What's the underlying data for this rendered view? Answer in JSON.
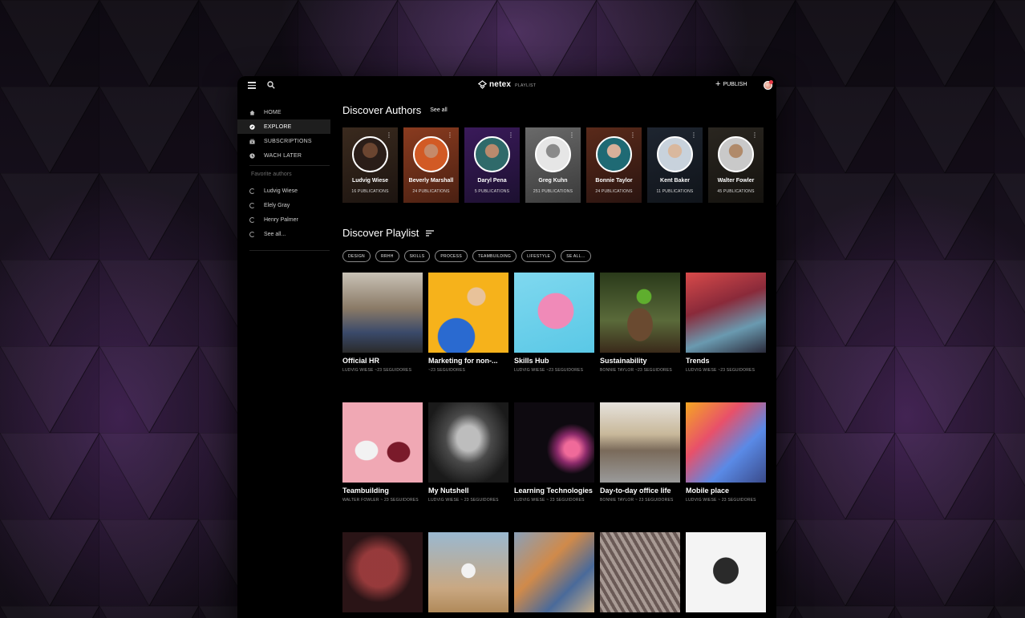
{
  "header": {
    "logo_name": "netex",
    "logo_sub": "PLAYLIST",
    "publish_label": "PUBLISH"
  },
  "sidebar": {
    "nav": [
      {
        "label": "HOME",
        "icon": "home-icon"
      },
      {
        "label": "EXPLORE",
        "icon": "compass-icon",
        "active": true
      },
      {
        "label": "SUBSCRIPTIONS",
        "icon": "subscriptions-icon"
      },
      {
        "label": "WACH LATER",
        "icon": "clock-icon"
      }
    ],
    "favorites_title": "Favorite authors",
    "favorites": [
      "Ludvig Wiese",
      "Elely Gray",
      "Henry Palmer",
      "See all..."
    ]
  },
  "authors_section": {
    "title": "Discover Authors",
    "see_all": "See all",
    "authors": [
      {
        "name": "Ludvig Wiese",
        "pubs": "16 PUBLICATIONS"
      },
      {
        "name": "Beverly Marshall",
        "pubs": "24 PUBLICATIONS"
      },
      {
        "name": "Daryl Pena",
        "pubs": "5 PUBLICATIONS"
      },
      {
        "name": "Greg Kuhn",
        "pubs": "251 PUBLICATIONS"
      },
      {
        "name": "Bonnie Taylor",
        "pubs": "24 PUBLICATIONS"
      },
      {
        "name": "Kent Baker",
        "pubs": "11 PUBLICATIONS"
      },
      {
        "name": "Walter Fowler",
        "pubs": "45 PUBLICATIONS"
      }
    ]
  },
  "playlist_section": {
    "title": "Discover Playlist",
    "filters": [
      "DESIGN",
      "RRHH",
      "SKILLS",
      "PROCESS",
      "TEAMBUILDING",
      "LIFESTYLE",
      "SE ALL..."
    ],
    "items": [
      {
        "title": "Official HR",
        "meta": "LUDVIG WIESE ~23 SEGUIDORES"
      },
      {
        "title": "Marketing for non-...",
        "meta": "~23 SEGUIDORES"
      },
      {
        "title": "Skills Hub",
        "meta": "LUDVIG WIESE ~23 SEGUIDORES"
      },
      {
        "title": "Sustainability",
        "meta": "BONNIE TAYLOR ~23 SEGUIDORES"
      },
      {
        "title": "Trends",
        "meta": "LUDVIG WIESE ~23 SEGUIDORES"
      },
      {
        "title": "Teambuilding",
        "meta": "WALTER FOWLER ~ 23 SEGUIDORES"
      },
      {
        "title": "My Nutshell",
        "meta": "LUDVIG WIESE ~ 23 SEGUIDORES"
      },
      {
        "title": "Learning Technologies",
        "meta": "LUDVIG WIESE ~ 23 SEGUIDORES"
      },
      {
        "title": "Day-to-day office life",
        "meta": "BONNIE TAYLOR ~ 23 SEGUIDORES"
      },
      {
        "title": "Mobile place",
        "meta": "LUDVIG WIESE ~ 23 SEGUIDORES"
      }
    ]
  }
}
